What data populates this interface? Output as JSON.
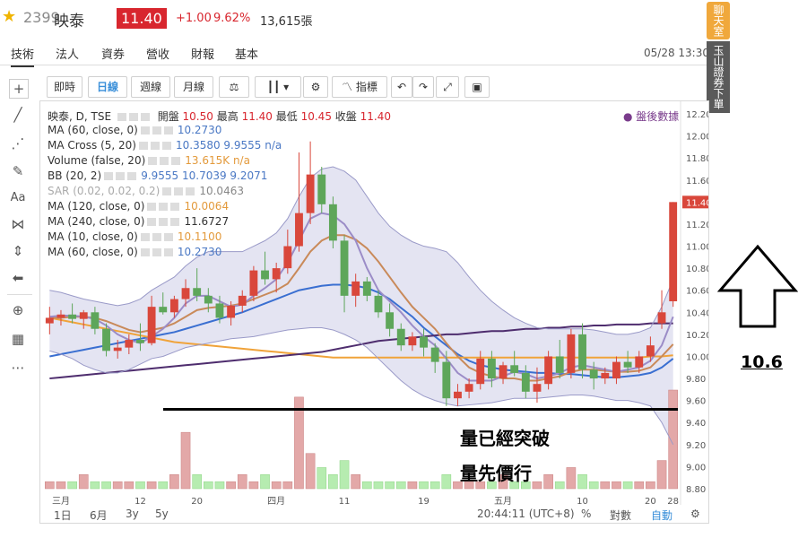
{
  "header": {
    "star_icon": "star-icon",
    "code": "2399",
    "name": "映泰",
    "price": "11.40",
    "change": "+1.00",
    "change_pct": "9.62%",
    "volume": "13,615張",
    "datetime": "05/28 13:30"
  },
  "tabs": [
    "技術",
    "法人",
    "資券",
    "營收",
    "財報",
    "基本"
  ],
  "side_banners": {
    "chat": "聊天室",
    "broker": "玉山證券下單"
  },
  "toolbar": {
    "buttons": [
      "即時",
      "日線",
      "週線",
      "月線"
    ],
    "active": "日線",
    "indicators_label": "指標"
  },
  "legend": {
    "main": {
      "label": "映泰, D, TSE",
      "open_label": "開盤",
      "open": "10.50",
      "high_label": "最高",
      "high": "11.40",
      "low_label": "最低",
      "low": "10.45",
      "close_label": "收盤",
      "close": "11.40"
    },
    "after_hours": "● 盤後數據",
    "rows": [
      {
        "label": "MA (60, close, 0)",
        "values": "10.2730"
      },
      {
        "label": "MA Cross (5, 20)",
        "values": "10.3580  9.9555  n/a"
      },
      {
        "label": "Volume (false, 20)",
        "values": "13.615K  n/a"
      },
      {
        "label": "BB (20, 2)",
        "values": "9.9555  10.7039  9.2071"
      },
      {
        "label": "SAR (0.02, 0.02, 0.2)",
        "values": "10.0463"
      },
      {
        "label": "MA (120, close, 0)",
        "values": "10.0064"
      },
      {
        "label": "MA (240, close, 0)",
        "values": "11.6727"
      },
      {
        "label": "MA (10, close, 0)",
        "values": "10.1100"
      },
      {
        "label": "MA (60, close, 0)",
        "values": "10.2730"
      }
    ]
  },
  "bottom_bar": {
    "ranges": [
      "1日",
      "6月",
      "3y",
      "5y"
    ],
    "time": "20:44:11 (UTC+8)",
    "percent": "%",
    "log": "對數",
    "auto": "自動"
  },
  "annotations": {
    "breakout_text": "量已經突破",
    "volume_first_text": "量先價行",
    "target_value": "10.6"
  },
  "chart_data": {
    "type": "candlestick",
    "title": "映泰, D, TSE",
    "ylim": [
      8.8,
      12.2
    ],
    "y_ticks": [
      "12.20",
      "12.00",
      "11.80",
      "11.60",
      "11.40",
      "11.20",
      "11.00",
      "10.80",
      "10.60",
      "10.40",
      "10.20",
      "10.00",
      "9.80",
      "9.60",
      "9.40",
      "9.20",
      "9.00",
      "8.80"
    ],
    "x_tick_labels": [
      "三月",
      "12",
      "20",
      "四月",
      "11",
      "19",
      "五月",
      "10",
      "20",
      "28"
    ],
    "last_price_label": "11.40",
    "candles": [
      {
        "o": 10.3,
        "h": 10.45,
        "l": 10.2,
        "c": 10.35
      },
      {
        "o": 10.35,
        "h": 10.42,
        "l": 10.28,
        "c": 10.38
      },
      {
        "o": 10.38,
        "h": 10.48,
        "l": 10.3,
        "c": 10.34
      },
      {
        "o": 10.34,
        "h": 10.42,
        "l": 10.25,
        "c": 10.4
      },
      {
        "o": 10.4,
        "h": 10.45,
        "l": 10.2,
        "c": 10.25
      },
      {
        "o": 10.25,
        "h": 10.3,
        "l": 10.0,
        "c": 10.05
      },
      {
        "o": 10.05,
        "h": 10.15,
        "l": 9.98,
        "c": 10.08
      },
      {
        "o": 10.08,
        "h": 10.2,
        "l": 10.02,
        "c": 10.15
      },
      {
        "o": 10.15,
        "h": 10.3,
        "l": 10.05,
        "c": 10.12
      },
      {
        "o": 10.12,
        "h": 10.55,
        "l": 10.1,
        "c": 10.45
      },
      {
        "o": 10.45,
        "h": 10.58,
        "l": 10.38,
        "c": 10.4
      },
      {
        "o": 10.4,
        "h": 10.55,
        "l": 10.35,
        "c": 10.52
      },
      {
        "o": 10.52,
        "h": 10.7,
        "l": 10.45,
        "c": 10.62
      },
      {
        "o": 10.62,
        "h": 10.8,
        "l": 10.5,
        "c": 10.55
      },
      {
        "o": 10.55,
        "h": 10.62,
        "l": 10.4,
        "c": 10.48
      },
      {
        "o": 10.48,
        "h": 10.55,
        "l": 10.3,
        "c": 10.35
      },
      {
        "o": 10.35,
        "h": 10.5,
        "l": 10.28,
        "c": 10.46
      },
      {
        "o": 10.46,
        "h": 10.6,
        "l": 10.4,
        "c": 10.55
      },
      {
        "o": 10.55,
        "h": 10.82,
        "l": 10.5,
        "c": 10.78
      },
      {
        "o": 10.78,
        "h": 10.95,
        "l": 10.65,
        "c": 10.7
      },
      {
        "o": 10.7,
        "h": 10.85,
        "l": 10.58,
        "c": 10.8
      },
      {
        "o": 10.8,
        "h": 11.15,
        "l": 10.75,
        "c": 11.0
      },
      {
        "o": 11.0,
        "h": 11.85,
        "l": 10.95,
        "c": 11.3
      },
      {
        "o": 11.3,
        "h": 11.95,
        "l": 11.2,
        "c": 11.65
      },
      {
        "o": 11.65,
        "h": 11.72,
        "l": 11.3,
        "c": 11.38
      },
      {
        "o": 11.38,
        "h": 11.45,
        "l": 10.98,
        "c": 11.05
      },
      {
        "o": 11.05,
        "h": 11.1,
        "l": 10.4,
        "c": 10.55
      },
      {
        "o": 10.55,
        "h": 10.75,
        "l": 10.45,
        "c": 10.68
      },
      {
        "o": 10.68,
        "h": 10.72,
        "l": 10.5,
        "c": 10.55
      },
      {
        "o": 10.55,
        "h": 10.6,
        "l": 10.35,
        "c": 10.4
      },
      {
        "o": 10.4,
        "h": 10.48,
        "l": 10.18,
        "c": 10.25
      },
      {
        "o": 10.25,
        "h": 10.3,
        "l": 10.05,
        "c": 10.1
      },
      {
        "o": 10.1,
        "h": 10.22,
        "l": 10.05,
        "c": 10.18
      },
      {
        "o": 10.18,
        "h": 10.25,
        "l": 10.0,
        "c": 10.08
      },
      {
        "o": 10.08,
        "h": 10.12,
        "l": 9.85,
        "c": 9.95
      },
      {
        "o": 9.95,
        "h": 10.05,
        "l": 9.55,
        "c": 9.62
      },
      {
        "o": 9.62,
        "h": 9.75,
        "l": 9.55,
        "c": 9.68
      },
      {
        "o": 9.68,
        "h": 9.8,
        "l": 9.62,
        "c": 9.75
      },
      {
        "o": 9.75,
        "h": 10.05,
        "l": 9.7,
        "c": 9.98
      },
      {
        "o": 9.98,
        "h": 10.05,
        "l": 9.72,
        "c": 9.8
      },
      {
        "o": 9.8,
        "h": 9.95,
        "l": 9.75,
        "c": 9.92
      },
      {
        "o": 9.92,
        "h": 10.05,
        "l": 9.82,
        "c": 9.85
      },
      {
        "o": 9.85,
        "h": 9.92,
        "l": 9.62,
        "c": 9.68
      },
      {
        "o": 9.68,
        "h": 9.9,
        "l": 9.58,
        "c": 9.75
      },
      {
        "o": 9.75,
        "h": 10.05,
        "l": 9.7,
        "c": 10.0
      },
      {
        "o": 10.0,
        "h": 10.15,
        "l": 9.8,
        "c": 9.85
      },
      {
        "o": 9.85,
        "h": 10.25,
        "l": 9.8,
        "c": 10.2
      },
      {
        "o": 10.2,
        "h": 10.3,
        "l": 9.8,
        "c": 9.88
      },
      {
        "o": 9.88,
        "h": 9.95,
        "l": 9.7,
        "c": 9.8
      },
      {
        "o": 9.8,
        "h": 9.9,
        "l": 9.75,
        "c": 9.85
      },
      {
        "o": 9.8,
        "h": 10.0,
        "l": 9.75,
        "c": 9.95
      },
      {
        "o": 9.95,
        "h": 10.05,
        "l": 9.85,
        "c": 9.9
      },
      {
        "o": 9.9,
        "h": 10.05,
        "l": 9.85,
        "c": 10.0
      },
      {
        "o": 10.0,
        "h": 10.18,
        "l": 9.95,
        "c": 10.1
      },
      {
        "o": 10.3,
        "h": 10.6,
        "l": 10.25,
        "c": 10.4
      },
      {
        "o": 10.5,
        "h": 11.4,
        "l": 10.45,
        "c": 11.4
      }
    ],
    "volumes": [
      1,
      1,
      1,
      2,
      1,
      1,
      1,
      1,
      1,
      1,
      1,
      2,
      8,
      2,
      1,
      1,
      1,
      2,
      1,
      2,
      1,
      1,
      13,
      5,
      3,
      2,
      4,
      2,
      1,
      1,
      1,
      1,
      1,
      1,
      1,
      2,
      1,
      1,
      1,
      1,
      2,
      1,
      1,
      1,
      2,
      1,
      3,
      2,
      1,
      1,
      1,
      1,
      1,
      1,
      4,
      14
    ],
    "series": [
      {
        "name": "MA (60, close, 0)",
        "color": "#3a6fd1",
        "values": [
          10.0,
          10.02,
          10.04,
          10.06,
          10.08,
          10.1,
          10.12,
          10.14,
          10.16,
          10.18,
          10.2,
          10.22,
          10.25,
          10.28,
          10.31,
          10.34,
          10.37,
          10.4,
          10.44,
          10.48,
          10.52,
          10.56,
          10.6,
          10.62,
          10.64,
          10.65,
          10.65,
          10.64,
          10.62,
          10.58,
          10.52,
          10.44,
          10.36,
          10.26,
          10.18,
          10.1,
          10.02,
          9.96,
          9.92,
          9.9,
          9.88,
          9.87,
          9.86,
          9.85,
          9.85,
          9.84,
          9.84,
          9.83,
          9.82,
          9.81,
          9.81,
          9.82,
          9.83,
          9.85,
          9.9,
          9.98
        ]
      },
      {
        "name": "MA (120, close, 0)",
        "color": "#f0a33a",
        "values": [
          10.35,
          10.33,
          10.31,
          10.29,
          10.27,
          10.25,
          10.23,
          10.21,
          10.19,
          10.17,
          10.15,
          10.13,
          10.12,
          10.11,
          10.1,
          10.09,
          10.08,
          10.07,
          10.06,
          10.05,
          10.04,
          10.03,
          10.02,
          10.01,
          10.0,
          9.99,
          9.99,
          9.99,
          9.99,
          9.99,
          9.99,
          9.99,
          9.99,
          9.99,
          9.99,
          9.99,
          9.99,
          9.99,
          9.99,
          9.99,
          9.99,
          9.99,
          9.99,
          9.99,
          9.99,
          9.99,
          9.99,
          9.99,
          9.99,
          9.99,
          9.99,
          9.99,
          9.99,
          10.0,
          10.0,
          10.01
        ]
      },
      {
        "name": "MA (240, close, 0)",
        "color": "#4e2d6e",
        "values": [
          9.8,
          9.81,
          9.82,
          9.83,
          9.84,
          9.85,
          9.86,
          9.87,
          9.88,
          9.89,
          9.9,
          9.91,
          9.92,
          9.93,
          9.94,
          9.95,
          9.96,
          9.97,
          9.98,
          9.99,
          10.0,
          10.01,
          10.02,
          10.03,
          10.04,
          10.06,
          10.08,
          10.1,
          10.12,
          10.14,
          10.15,
          10.16,
          10.17,
          10.18,
          10.19,
          10.2,
          10.2,
          10.21,
          10.22,
          10.23,
          10.23,
          10.24,
          10.25,
          10.25,
          10.26,
          10.26,
          10.27,
          10.27,
          10.28,
          10.28,
          10.29,
          10.29,
          10.29,
          10.3,
          10.3,
          10.3
        ]
      },
      {
        "name": "MA (10, close, 0)",
        "color": "#c98a5a",
        "values": [
          10.35,
          10.35,
          10.36,
          10.36,
          10.35,
          10.32,
          10.28,
          10.24,
          10.22,
          10.24,
          10.26,
          10.3,
          10.36,
          10.42,
          10.44,
          10.45,
          10.46,
          10.48,
          10.52,
          10.56,
          10.6,
          10.66,
          10.8,
          10.95,
          11.05,
          11.1,
          11.1,
          11.06,
          10.98,
          10.86,
          10.72,
          10.58,
          10.45,
          10.35,
          10.25,
          10.12,
          10.0,
          9.9,
          9.85,
          9.82,
          9.8,
          9.8,
          9.78,
          9.78,
          9.8,
          9.82,
          9.86,
          9.88,
          9.88,
          9.87,
          9.86,
          9.86,
          9.87,
          9.9,
          10.0,
          10.11
        ]
      },
      {
        "name": "MA (5)",
        "color": "#9b8cc7",
        "values": [
          10.36,
          10.37,
          10.37,
          10.36,
          10.34,
          10.28,
          10.2,
          10.15,
          10.12,
          10.18,
          10.25,
          10.35,
          10.48,
          10.55,
          10.55,
          10.5,
          10.45,
          10.47,
          10.55,
          10.62,
          10.7,
          10.85,
          11.05,
          11.25,
          11.3,
          11.28,
          11.2,
          11.05,
          10.8,
          10.6,
          10.5,
          10.4,
          10.28,
          10.18,
          10.1,
          9.98,
          9.85,
          9.78,
          9.78,
          9.78,
          9.82,
          9.86,
          9.84,
          9.8,
          9.82,
          9.85,
          9.9,
          9.92,
          9.9,
          9.88,
          9.86,
          9.88,
          9.9,
          9.96,
          10.1,
          10.36
        ]
      },
      {
        "name": "BB upper",
        "color": "#9a9ac8",
        "values": [
          10.6,
          10.58,
          10.55,
          10.52,
          10.5,
          10.48,
          10.46,
          10.48,
          10.52,
          10.6,
          10.66,
          10.72,
          10.82,
          10.9,
          10.95,
          10.95,
          10.95,
          10.95,
          11.0,
          11.05,
          11.12,
          11.25,
          11.45,
          11.62,
          11.7,
          11.72,
          11.68,
          11.6,
          11.45,
          11.3,
          11.18,
          11.1,
          11.04,
          11.0,
          10.98,
          10.95,
          10.85,
          10.72,
          10.6,
          10.5,
          10.42,
          10.35,
          10.3,
          10.26,
          10.25,
          10.25,
          10.25,
          10.25,
          10.24,
          10.22,
          10.2,
          10.2,
          10.22,
          10.26,
          10.45,
          10.7
        ]
      },
      {
        "name": "BB lower",
        "color": "#9a9ac8",
        "values": [
          10.05,
          10.02,
          9.98,
          9.92,
          9.88,
          9.85,
          9.85,
          9.88,
          9.93,
          9.98,
          10.0,
          10.04,
          10.08,
          10.1,
          10.12,
          10.14,
          10.16,
          10.17,
          10.18,
          10.2,
          10.22,
          10.24,
          10.25,
          10.26,
          10.26,
          10.24,
          10.2,
          10.15,
          10.08,
          9.98,
          9.88,
          9.78,
          9.7,
          9.64,
          9.6,
          9.57,
          9.55,
          9.56,
          9.57,
          9.58,
          9.6,
          9.62,
          9.62,
          9.62,
          9.63,
          9.64,
          9.65,
          9.65,
          9.64,
          9.62,
          9.6,
          9.6,
          9.58,
          9.55,
          9.4,
          9.2
        ]
      }
    ]
  }
}
